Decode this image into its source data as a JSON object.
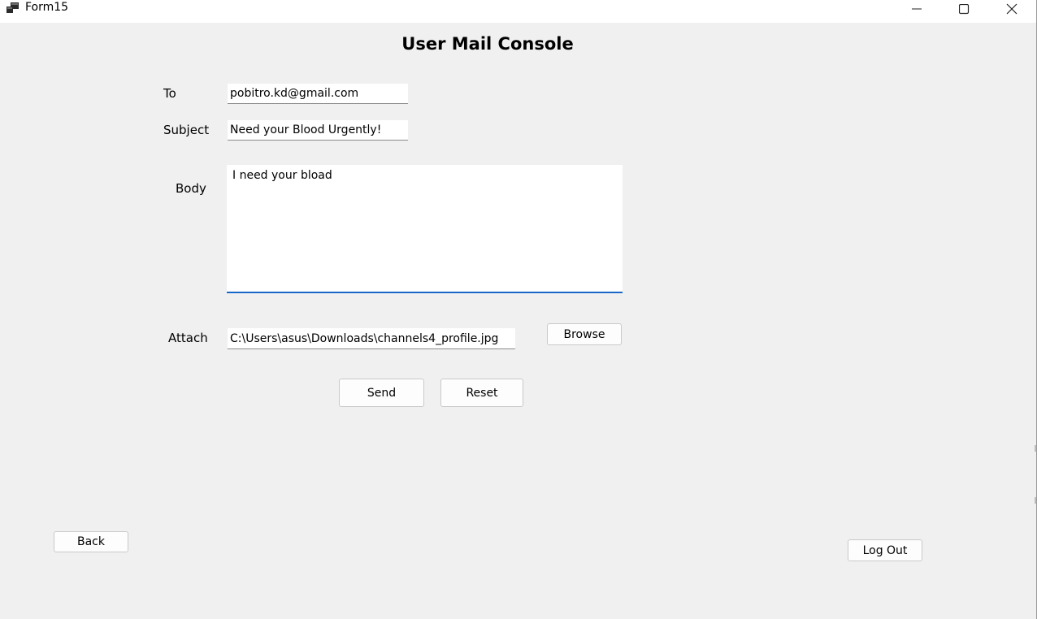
{
  "window": {
    "title": "Form15",
    "icons": {
      "app": "app-icon",
      "minimize": "minimize-icon",
      "maximize": "maximize-icon",
      "close": "close-icon"
    }
  },
  "form": {
    "heading": "User Mail Console",
    "to": {
      "label": "To",
      "value": "pobitro.kd@gmail.com"
    },
    "subject": {
      "label": "Subject",
      "value": "Need your Blood Urgently!"
    },
    "body": {
      "label": "Body",
      "value": "I need your bload"
    },
    "attach": {
      "label": "Attach",
      "value": "C:\\Users\\asus\\Downloads\\channels4_profile.jpg"
    }
  },
  "buttons": {
    "browse": "Browse",
    "send": "Send",
    "reset": "Reset",
    "back": "Back",
    "logout": "Log Out"
  },
  "colors": {
    "background": "#f0f0f0",
    "focus_accent": "#1967c8"
  }
}
